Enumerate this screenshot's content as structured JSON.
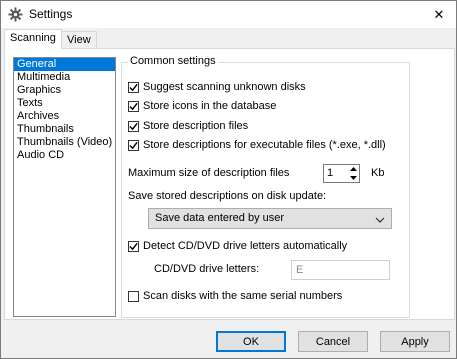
{
  "window": {
    "title": "Settings",
    "icon": "gear-icon",
    "close_glyph": "✕"
  },
  "tabs": [
    {
      "label": "Scanning",
      "active": true
    },
    {
      "label": "View",
      "active": false
    }
  ],
  "categories": {
    "items": [
      "General",
      "Multimedia",
      "Graphics",
      "Texts",
      "Archives",
      "Thumbnails",
      "Thumbnails (Video)",
      "Audio CD"
    ],
    "selected": "General"
  },
  "common": {
    "group_title": "Common settings",
    "suggest_label": "Suggest scanning unknown disks",
    "suggest_checked": true,
    "store_icons_label": "Store icons in the database",
    "store_icons_checked": true,
    "store_desc_label": "Store description files",
    "store_desc_checked": true,
    "store_desc_exe_label": "Store descriptions for executable files (*.exe, *.dll)",
    "store_desc_exe_checked": true,
    "max_size_label": "Maximum size of description files",
    "max_size_value": "1",
    "max_size_unit": "Kb",
    "save_desc_label": "Save stored descriptions on disk update:",
    "save_desc_value": "Save data entered by user",
    "detect_label": "Detect CD/DVD drive letters automatically",
    "detect_checked": true,
    "drive_letters_label": "CD/DVD drive letters:",
    "drive_letters_value": "E",
    "scan_serial_label": "Scan disks with the same serial numbers",
    "scan_serial_checked": false
  },
  "buttons": {
    "ok": "OK",
    "cancel": "Cancel",
    "apply": "Apply"
  },
  "colors": {
    "selection": "#0078d7",
    "window_bg": "#f0f0f0",
    "panel_bg": "#ffffff"
  }
}
